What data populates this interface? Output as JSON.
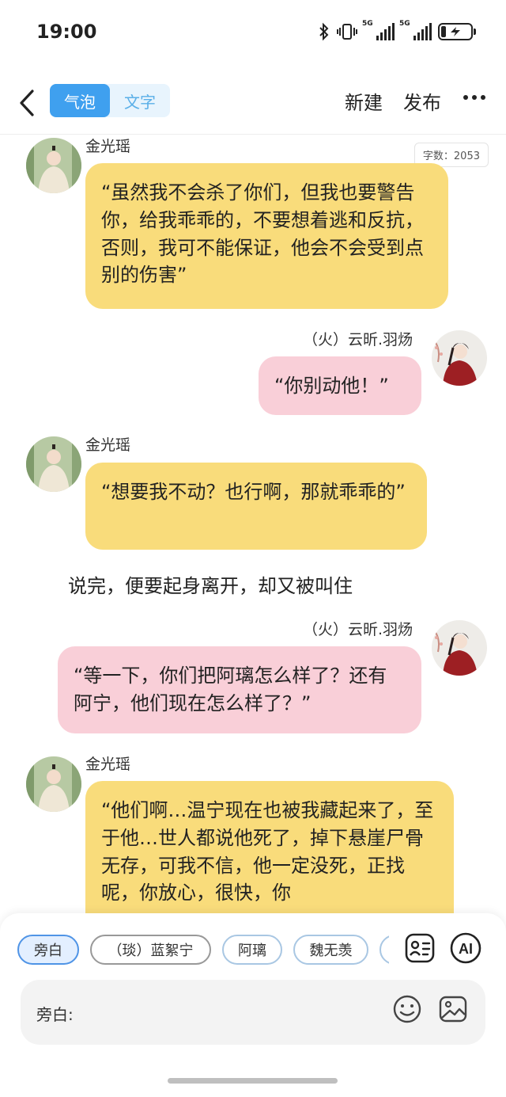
{
  "status": {
    "time": "19:00",
    "sim1": "5G",
    "sim2": "5G"
  },
  "header": {
    "mode_bubble": "气泡",
    "mode_text": "文字",
    "new_label": "新建",
    "publish_label": "发布"
  },
  "word_count": "字数：2053",
  "messages": [
    {
      "speaker": "金光瑶",
      "side": "left",
      "color": "#f9dc7b",
      "text": "“虽然我不会杀了你们，但我也要警告你，给我乖乖的，不要想着逃和反抗，否则，我可不能保证，他会不会受到点别的伤害”"
    },
    {
      "speaker": "（火）云昕.羽炀",
      "side": "right",
      "color": "#f9cfd8",
      "text": "“你别动他！”"
    },
    {
      "speaker": "金光瑶",
      "side": "left",
      "color": "#f9dc7b",
      "text": "“想要我不动？也行啊，那就乖乖的”"
    },
    {
      "narration": "说完，便要起身离开，却又被叫住"
    },
    {
      "speaker": "（火）云昕.羽炀",
      "side": "right",
      "color": "#f9cfd8",
      "text": "“等一下，你们把阿璃怎么样了？还有阿宁，他们现在怎么样了？”"
    },
    {
      "speaker": "金光瑶",
      "side": "left",
      "color": "#f9dc7b",
      "text": "“他们啊…温宁现在也被我藏起来了，至于他…世人都说他死了，掉下悬崖尸骨无存，可我不信，他一定没死，正找呢，你放心，很快，你"
    }
  ],
  "chips": [
    "旁白",
    "（琰）蓝絮宁",
    "阿璃",
    "魏无羡"
  ],
  "input": {
    "label": "旁白:"
  },
  "icons": [
    "back-arrow-icon",
    "more-icon",
    "character-card-icon",
    "ai-icon",
    "emoji-icon",
    "image-icon"
  ]
}
